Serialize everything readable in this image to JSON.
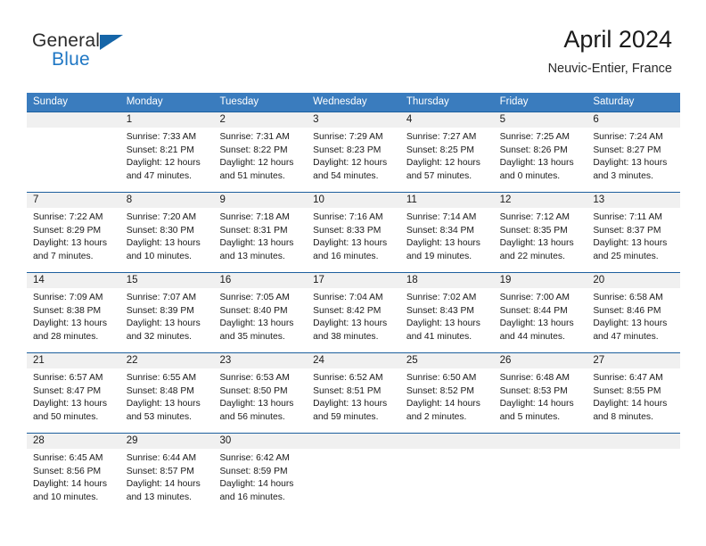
{
  "brand": {
    "line1": "General",
    "line2": "Blue",
    "logo_icon": "triangle-flag-icon",
    "accent_color": "#1565a8",
    "blue_text_color": "#1f77c4"
  },
  "header": {
    "title": "April 2024",
    "subtitle": "Neuvic-Entier, France"
  },
  "calendar": {
    "header_bg": "#3a7cbe",
    "row_rule_color": "#1d5f9e",
    "number_band_bg": "#f0f0f0",
    "weekdays": [
      "Sunday",
      "Monday",
      "Tuesday",
      "Wednesday",
      "Thursday",
      "Friday",
      "Saturday"
    ],
    "weeks": [
      {
        "days": [
          {
            "num": "",
            "empty": true
          },
          {
            "num": "1",
            "sunrise": "Sunrise: 7:33 AM",
            "sunset": "Sunset: 8:21 PM",
            "daylight_1": "Daylight: 12 hours",
            "daylight_2": "and 47 minutes."
          },
          {
            "num": "2",
            "sunrise": "Sunrise: 7:31 AM",
            "sunset": "Sunset: 8:22 PM",
            "daylight_1": "Daylight: 12 hours",
            "daylight_2": "and 51 minutes."
          },
          {
            "num": "3",
            "sunrise": "Sunrise: 7:29 AM",
            "sunset": "Sunset: 8:23 PM",
            "daylight_1": "Daylight: 12 hours",
            "daylight_2": "and 54 minutes."
          },
          {
            "num": "4",
            "sunrise": "Sunrise: 7:27 AM",
            "sunset": "Sunset: 8:25 PM",
            "daylight_1": "Daylight: 12 hours",
            "daylight_2": "and 57 minutes."
          },
          {
            "num": "5",
            "sunrise": "Sunrise: 7:25 AM",
            "sunset": "Sunset: 8:26 PM",
            "daylight_1": "Daylight: 13 hours",
            "daylight_2": "and 0 minutes."
          },
          {
            "num": "6",
            "sunrise": "Sunrise: 7:24 AM",
            "sunset": "Sunset: 8:27 PM",
            "daylight_1": "Daylight: 13 hours",
            "daylight_2": "and 3 minutes."
          }
        ]
      },
      {
        "days": [
          {
            "num": "7",
            "sunrise": "Sunrise: 7:22 AM",
            "sunset": "Sunset: 8:29 PM",
            "daylight_1": "Daylight: 13 hours",
            "daylight_2": "and 7 minutes."
          },
          {
            "num": "8",
            "sunrise": "Sunrise: 7:20 AM",
            "sunset": "Sunset: 8:30 PM",
            "daylight_1": "Daylight: 13 hours",
            "daylight_2": "and 10 minutes."
          },
          {
            "num": "9",
            "sunrise": "Sunrise: 7:18 AM",
            "sunset": "Sunset: 8:31 PM",
            "daylight_1": "Daylight: 13 hours",
            "daylight_2": "and 13 minutes."
          },
          {
            "num": "10",
            "sunrise": "Sunrise: 7:16 AM",
            "sunset": "Sunset: 8:33 PM",
            "daylight_1": "Daylight: 13 hours",
            "daylight_2": "and 16 minutes."
          },
          {
            "num": "11",
            "sunrise": "Sunrise: 7:14 AM",
            "sunset": "Sunset: 8:34 PM",
            "daylight_1": "Daylight: 13 hours",
            "daylight_2": "and 19 minutes."
          },
          {
            "num": "12",
            "sunrise": "Sunrise: 7:12 AM",
            "sunset": "Sunset: 8:35 PM",
            "daylight_1": "Daylight: 13 hours",
            "daylight_2": "and 22 minutes."
          },
          {
            "num": "13",
            "sunrise": "Sunrise: 7:11 AM",
            "sunset": "Sunset: 8:37 PM",
            "daylight_1": "Daylight: 13 hours",
            "daylight_2": "and 25 minutes."
          }
        ]
      },
      {
        "days": [
          {
            "num": "14",
            "sunrise": "Sunrise: 7:09 AM",
            "sunset": "Sunset: 8:38 PM",
            "daylight_1": "Daylight: 13 hours",
            "daylight_2": "and 28 minutes."
          },
          {
            "num": "15",
            "sunrise": "Sunrise: 7:07 AM",
            "sunset": "Sunset: 8:39 PM",
            "daylight_1": "Daylight: 13 hours",
            "daylight_2": "and 32 minutes."
          },
          {
            "num": "16",
            "sunrise": "Sunrise: 7:05 AM",
            "sunset": "Sunset: 8:40 PM",
            "daylight_1": "Daylight: 13 hours",
            "daylight_2": "and 35 minutes."
          },
          {
            "num": "17",
            "sunrise": "Sunrise: 7:04 AM",
            "sunset": "Sunset: 8:42 PM",
            "daylight_1": "Daylight: 13 hours",
            "daylight_2": "and 38 minutes."
          },
          {
            "num": "18",
            "sunrise": "Sunrise: 7:02 AM",
            "sunset": "Sunset: 8:43 PM",
            "daylight_1": "Daylight: 13 hours",
            "daylight_2": "and 41 minutes."
          },
          {
            "num": "19",
            "sunrise": "Sunrise: 7:00 AM",
            "sunset": "Sunset: 8:44 PM",
            "daylight_1": "Daylight: 13 hours",
            "daylight_2": "and 44 minutes."
          },
          {
            "num": "20",
            "sunrise": "Sunrise: 6:58 AM",
            "sunset": "Sunset: 8:46 PM",
            "daylight_1": "Daylight: 13 hours",
            "daylight_2": "and 47 minutes."
          }
        ]
      },
      {
        "days": [
          {
            "num": "21",
            "sunrise": "Sunrise: 6:57 AM",
            "sunset": "Sunset: 8:47 PM",
            "daylight_1": "Daylight: 13 hours",
            "daylight_2": "and 50 minutes."
          },
          {
            "num": "22",
            "sunrise": "Sunrise: 6:55 AM",
            "sunset": "Sunset: 8:48 PM",
            "daylight_1": "Daylight: 13 hours",
            "daylight_2": "and 53 minutes."
          },
          {
            "num": "23",
            "sunrise": "Sunrise: 6:53 AM",
            "sunset": "Sunset: 8:50 PM",
            "daylight_1": "Daylight: 13 hours",
            "daylight_2": "and 56 minutes."
          },
          {
            "num": "24",
            "sunrise": "Sunrise: 6:52 AM",
            "sunset": "Sunset: 8:51 PM",
            "daylight_1": "Daylight: 13 hours",
            "daylight_2": "and 59 minutes."
          },
          {
            "num": "25",
            "sunrise": "Sunrise: 6:50 AM",
            "sunset": "Sunset: 8:52 PM",
            "daylight_1": "Daylight: 14 hours",
            "daylight_2": "and 2 minutes."
          },
          {
            "num": "26",
            "sunrise": "Sunrise: 6:48 AM",
            "sunset": "Sunset: 8:53 PM",
            "daylight_1": "Daylight: 14 hours",
            "daylight_2": "and 5 minutes."
          },
          {
            "num": "27",
            "sunrise": "Sunrise: 6:47 AM",
            "sunset": "Sunset: 8:55 PM",
            "daylight_1": "Daylight: 14 hours",
            "daylight_2": "and 8 minutes."
          }
        ]
      },
      {
        "days": [
          {
            "num": "28",
            "sunrise": "Sunrise: 6:45 AM",
            "sunset": "Sunset: 8:56 PM",
            "daylight_1": "Daylight: 14 hours",
            "daylight_2": "and 10 minutes."
          },
          {
            "num": "29",
            "sunrise": "Sunrise: 6:44 AM",
            "sunset": "Sunset: 8:57 PM",
            "daylight_1": "Daylight: 14 hours",
            "daylight_2": "and 13 minutes."
          },
          {
            "num": "30",
            "sunrise": "Sunrise: 6:42 AM",
            "sunset": "Sunset: 8:59 PM",
            "daylight_1": "Daylight: 14 hours",
            "daylight_2": "and 16 minutes."
          },
          {
            "num": "",
            "empty": true
          },
          {
            "num": "",
            "empty": true
          },
          {
            "num": "",
            "empty": true
          },
          {
            "num": "",
            "empty": true
          }
        ]
      }
    ]
  }
}
